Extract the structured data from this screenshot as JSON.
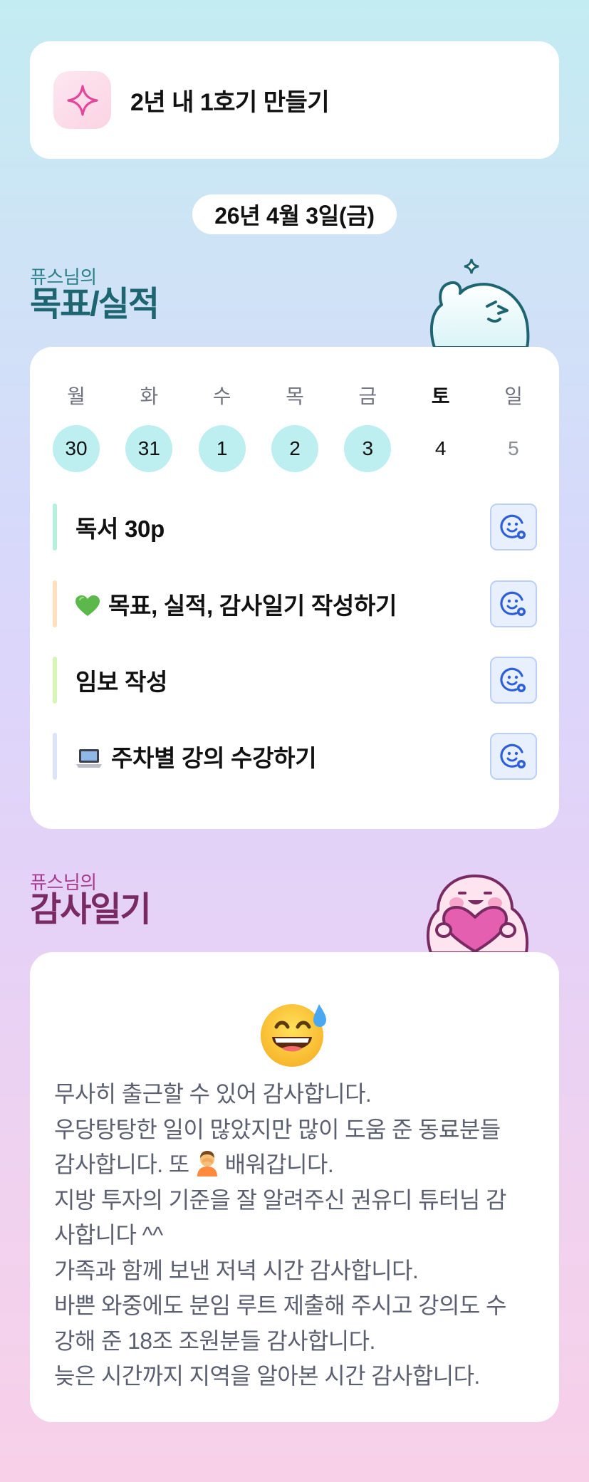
{
  "goal": {
    "icon": "sparkle-icon",
    "title": "2년 내 1호기 만들기"
  },
  "date": {
    "label": "26년 4월 3일(금)"
  },
  "goals_section": {
    "subtitle": "퓨스님의",
    "title": "목표/실적",
    "mascot": "waving-mascot-icon"
  },
  "week": {
    "days": [
      {
        "name": "월",
        "num": "30",
        "done": true
      },
      {
        "name": "화",
        "num": "31",
        "done": true
      },
      {
        "name": "수",
        "num": "1",
        "done": true
      },
      {
        "name": "목",
        "num": "2",
        "done": true
      },
      {
        "name": "금",
        "num": "3",
        "done": true
      },
      {
        "name": "토",
        "num": "4",
        "done": false
      },
      {
        "name": "일",
        "num": "5",
        "done": false
      }
    ]
  },
  "tasks": [
    {
      "label": "독서 30p",
      "bar_color": "#b5f0dc",
      "button_icon": "smiley-check-icon"
    },
    {
      "emoji": "green-heart-icon",
      "label": "목표, 실적, 감사일기 작성하기",
      "bar_color": "#fde0c0",
      "button_icon": "smiley-check-icon"
    },
    {
      "label": "임보 작성",
      "bar_color": "#d8f5b8",
      "button_icon": "smiley-check-icon"
    },
    {
      "emoji": "laptop-icon",
      "label": "주차별 강의 수강하기",
      "bar_color": "#dce4f8",
      "button_icon": "smiley-check-icon"
    }
  ],
  "thanks_section": {
    "subtitle": "퓨스님의",
    "title": "감사일기",
    "mascot": "heart-mascot-icon"
  },
  "thanks": {
    "emoji": "grinning-sweat-emoji",
    "lines": [
      "무사히 출근할 수 있어 감사합니다.",
      "우당탕탕한 일이 많았지만 많이 도움 준 동료분들",
      "감사합니다. 또",
      "배워갑니다.",
      "지방 투자의 기준을 잘 알려주신 권유디 튜터님 감",
      "사합니다 ^^",
      "가족과 함께 보낸 저녁 시간 감사합니다.",
      "바쁜 와중에도 분임 루트 제출해 주시고 강의도 수",
      "강해 준 18조 조원분들 감사합니다.",
      "늦은 시간까지 지역을 알아본 시간 감사합니다."
    ],
    "inline_emoji": "person-facepalming-emoji"
  }
}
